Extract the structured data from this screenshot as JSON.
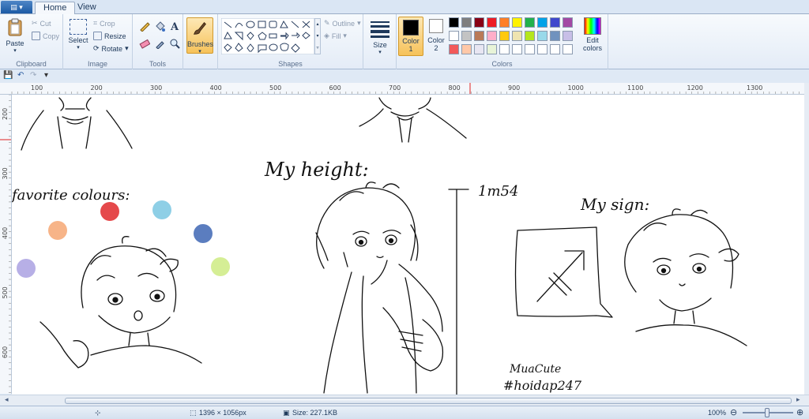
{
  "tabs": {
    "app_menu": "▤ ▾",
    "home": "Home",
    "view": "View"
  },
  "clipboard": {
    "paste": "Paste",
    "cut": "Cut",
    "copy": "Copy",
    "label": "Clipboard"
  },
  "image": {
    "select": "Select",
    "crop": "Crop",
    "resize": "Resize",
    "rotate": "Rotate",
    "label": "Image"
  },
  "tools": {
    "label": "Tools"
  },
  "brushes": {
    "label": "Brushes"
  },
  "shapes": {
    "outline": "Outline",
    "fill": "Fill",
    "label": "Shapes"
  },
  "size": {
    "label": "Size"
  },
  "colors": {
    "color1_label": "Color",
    "color1_num": "1",
    "color2_label": "Color",
    "color2_num": "2",
    "edit_colors_1": "Edit",
    "edit_colors_2": "colors",
    "label": "Colors",
    "color1": "#000000",
    "color2": "#ffffff",
    "palette_row1": [
      "#000000",
      "#7f7f7f",
      "#880015",
      "#ed1c24",
      "#ff7f27",
      "#fff200",
      "#22b14c",
      "#00a2e8",
      "#3f48cc",
      "#a349a4"
    ],
    "palette_row2": [
      "#ffffff",
      "#c3c3c3",
      "#b97a57",
      "#ffaec9",
      "#ffc90e",
      "#efe4b0",
      "#b5e61d",
      "#99d9ea",
      "#7092be",
      "#c8bfe7"
    ],
    "palette_row3": [
      "#f25a5a",
      "#ffc8a8",
      "#e8e6f2",
      "#e8f4d8",
      "#ffffff",
      "#ffffff",
      "#ffffff",
      "#ffffff",
      "#ffffff",
      "#ffffff"
    ]
  },
  "ruler_top": [
    "100",
    "200",
    "300",
    "400",
    "500",
    "600",
    "700",
    "800",
    "900",
    "1000",
    "1100",
    "1200",
    "1300"
  ],
  "ruler_left": [
    "200",
    "300",
    "400",
    "500",
    "600"
  ],
  "canvas": {
    "favorite_colours": "favorite colours:",
    "my_height": "My height:",
    "height_value": "1m54",
    "my_sign": "My sign:",
    "signature_1": "MuaCute",
    "signature_2": "#hoidap247",
    "dots": [
      "#e5494b",
      "#8ecfe6",
      "#f7b488",
      "#5b7dbf",
      "#b7afe6",
      "#d5ee95"
    ]
  },
  "status": {
    "dimensions": "1396 × 1056px",
    "size": "Size: 227.1KB",
    "zoom": "100%",
    "zoom_level": 1.0
  }
}
